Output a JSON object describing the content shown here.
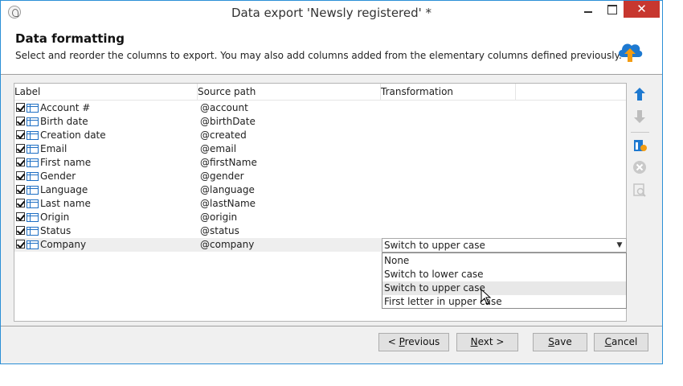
{
  "window": {
    "title": "Data export 'Newsly registered' *"
  },
  "header": {
    "title": "Data formatting",
    "subtitle": "Select and reorder the columns to export. You may also add columns added from the elementary columns defined previously."
  },
  "grid": {
    "columns": [
      "Label",
      "Source path",
      "Transformation"
    ],
    "rows": [
      {
        "label": "Account #",
        "path": "@account",
        "checked": true
      },
      {
        "label": "Birth date",
        "path": "@birthDate",
        "checked": true
      },
      {
        "label": "Creation date",
        "path": "@created",
        "checked": true
      },
      {
        "label": "Email",
        "path": "@email",
        "checked": true
      },
      {
        "label": "First name",
        "path": "@firstName",
        "checked": true
      },
      {
        "label": "Gender",
        "path": "@gender",
        "checked": true
      },
      {
        "label": "Language",
        "path": "@language",
        "checked": true
      },
      {
        "label": "Last name",
        "path": "@lastName",
        "checked": true
      },
      {
        "label": "Origin",
        "path": "@origin",
        "checked": true
      },
      {
        "label": "Status",
        "path": "@status",
        "checked": true
      },
      {
        "label": "Company",
        "path": "@company",
        "checked": true,
        "selected": true
      }
    ],
    "transformation_select": {
      "value": "Switch to upper case",
      "options": [
        "None",
        "Switch to lower case",
        "Switch to upper case",
        "First letter in upper case"
      ],
      "hovered": "Switch to upper case"
    }
  },
  "toolbar": {
    "icons": [
      "arrow-up-icon",
      "arrow-down-icon",
      "add-column-icon",
      "delete-icon",
      "detail-icon"
    ]
  },
  "buttons": {
    "previous": {
      "pre": "< ",
      "mn": "P",
      "rest": "revious"
    },
    "next": {
      "pre": "",
      "mn": "N",
      "rest": "ext >"
    },
    "save": {
      "pre": "",
      "mn": "S",
      "rest": "ave"
    },
    "cancel": {
      "pre": "",
      "mn": "C",
      "rest": "ancel"
    }
  },
  "colors": {
    "accent": "#1e79d0",
    "close": "#c7372f",
    "border": "#2b8fd6"
  }
}
